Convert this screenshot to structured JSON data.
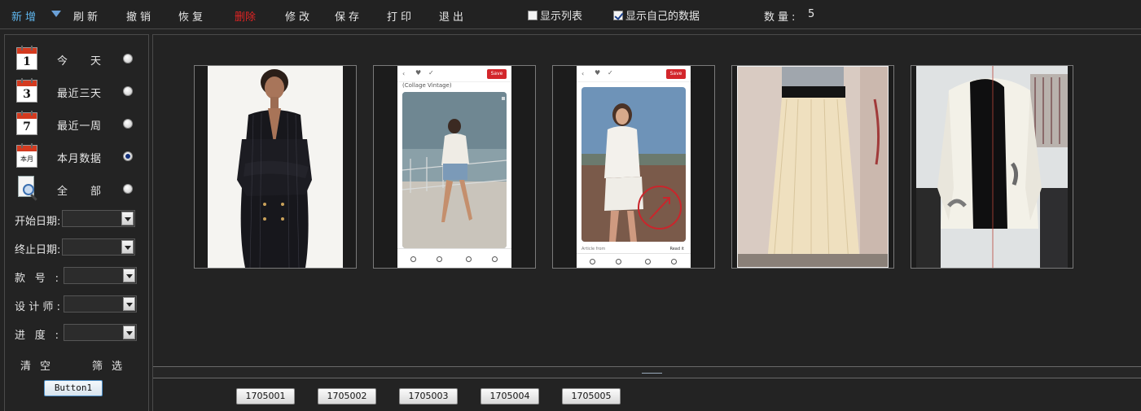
{
  "toolbar": {
    "add": "新增",
    "refresh": "刷新",
    "undo": "撤销",
    "restore": "恢复",
    "delete": "删除",
    "edit": "修改",
    "save": "保存",
    "print": "打印",
    "exit": "退出",
    "show_list": {
      "label": "显示列表",
      "checked": false
    },
    "show_own": {
      "label": "显示自己的数据",
      "checked": true
    },
    "count_label": "数量:",
    "count_value": "5"
  },
  "sidebar": {
    "date_options": [
      {
        "icon": "calendar-1-icon",
        "cal_text": "1",
        "label": "今天",
        "selected": false
      },
      {
        "icon": "calendar-3-icon",
        "cal_text": "3",
        "label": "最近三天",
        "selected": false
      },
      {
        "icon": "calendar-7-icon",
        "cal_text": "7",
        "label": "最近一周",
        "selected": false
      },
      {
        "icon": "calendar-month-icon",
        "cal_text": "本月",
        "label": "本月数据",
        "selected": true
      },
      {
        "icon": "search-document-icon",
        "cal_text": "",
        "label": "全部",
        "selected": false
      }
    ],
    "fields": [
      {
        "label": "开始日期:",
        "value": ""
      },
      {
        "label": "终止日期:",
        "value": ""
      },
      {
        "label": "款号:",
        "value": ""
      },
      {
        "label": "设计师:",
        "value": ""
      },
      {
        "label": "进度:",
        "value": ""
      }
    ],
    "clear": "清空",
    "filter": "筛选",
    "button1": "Button1"
  },
  "gallery": {
    "screenshot_caption": "(Collage Vintage)",
    "phone_foot_text": "Article from",
    "phone_foot_right": "Read it",
    "save_label": "Save",
    "items": [
      {
        "sku": "1705001",
        "kind": "photo-black-dress"
      },
      {
        "sku": "1705002",
        "kind": "phone-screenshot-street"
      },
      {
        "sku": "1705003",
        "kind": "phone-screenshot-field"
      },
      {
        "sku": "1705004",
        "kind": "photo-skirt"
      },
      {
        "sku": "1705005",
        "kind": "photo-coat"
      }
    ]
  },
  "colors": {
    "accent_blue": "#5fb6ee",
    "delete_red": "#e02424",
    "background": "#232323",
    "text": "#e6e6e6"
  }
}
